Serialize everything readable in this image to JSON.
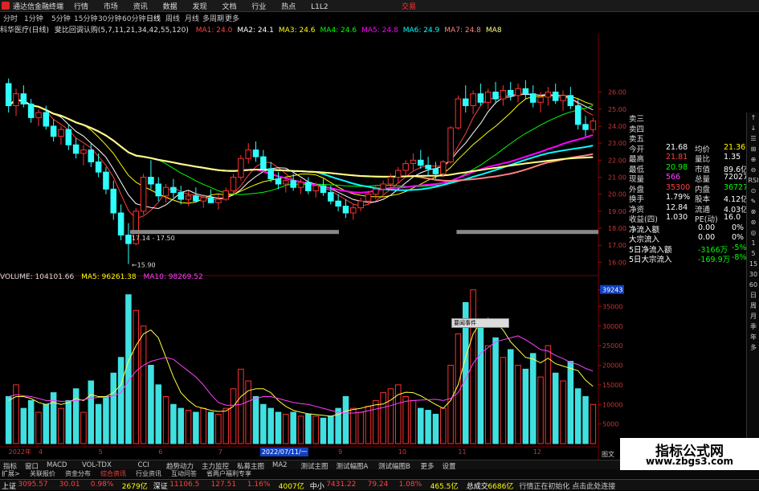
{
  "titlebar": {
    "app_title": "通达信金融终端",
    "menus": [
      "行情",
      "市场",
      "资讯",
      "数据",
      "发现",
      "文档",
      "行业",
      "热点",
      "L1L2"
    ],
    "trade": "交易"
  },
  "periods": [
    "分时",
    "1分钟",
    "5分钟",
    "15分钟",
    "30分钟",
    "60分钟",
    "日线",
    "周线",
    "月线",
    "多周期",
    "更多"
  ],
  "indicator_line": {
    "stock": "科华医疗(日线)",
    "formula": "斐比回调认购(5,7,11,21,34,42,55,120)",
    "mas": [
      {
        "label": "MA1: 24.0",
        "color": "#ff4040"
      },
      {
        "label": "MA2: 24.1",
        "color": "#ffffff"
      },
      {
        "label": "MA3: 24.6",
        "color": "#ffff00"
      },
      {
        "label": "MA4: 24.6",
        "color": "#00ff00"
      },
      {
        "label": "MA5: 24.8",
        "color": "#ff00ff"
      },
      {
        "label": "MA6: 24.9",
        "color": "#00ffff"
      },
      {
        "label": "MA7: 24.8",
        "color": "#ff8080"
      },
      {
        "label": "MA8",
        "color": "#ffff80"
      }
    ]
  },
  "price_axis": [
    "26.00",
    "25.00",
    "24.00",
    "23.00",
    "22.00",
    "21.00",
    "20.00",
    "19.00",
    "18.00",
    "17.00",
    "16.00"
  ],
  "price_annotations": {
    "low_label": "15.90",
    "range_label": "17.14 - 17.50"
  },
  "volume_line": {
    "volume": "VOLUME: 104101.66",
    "ma5": "MA5: 96261.38",
    "ma10": "MA10: 98269.52"
  },
  "volume_axis": [
    "39243",
    "35000",
    "30000",
    "25000",
    "20000",
    "15000",
    "10000",
    "5000"
  ],
  "volume_tooltip": "要闻事件",
  "date_axis": [
    "2022年",
    "4",
    "5",
    "6",
    "7",
    "8",
    "9",
    "10",
    "11",
    "12"
  ],
  "date_highlight": "2022/07/11/一",
  "quote": {
    "order_labels": [
      "卖三",
      "卖四",
      "卖五"
    ],
    "rows": [
      {
        "l1": "今开",
        "v1": "21.68",
        "c1": "#ffffff",
        "l2": "均价",
        "v2": "21.36",
        "c2": "#ffff00"
      },
      {
        "l1": "最高",
        "v1": "21.81",
        "c1": "#ff4040",
        "l2": "量比",
        "v2": "1.35",
        "c2": "#ffffff"
      },
      {
        "l1": "最低",
        "v1": "20.98",
        "c1": "#00ff00",
        "l2": "市值",
        "v2": "89.6亿",
        "c2": "#ffffff"
      },
      {
        "l1": "现量",
        "v1": "566",
        "c1": "#ff40ff",
        "l2": "总量",
        "v2": "72027",
        "c2": "#ffffff"
      },
      {
        "l1": "外盘",
        "v1": "35300",
        "c1": "#ff4040",
        "l2": "内盘",
        "v2": "36727",
        "c2": "#00ff00"
      },
      {
        "l1": "换手",
        "v1": "1.79%",
        "c1": "#ffffff",
        "l2": "股本",
        "v2": "4.12亿",
        "c2": "#ffffff"
      },
      {
        "l1": "净资",
        "v1": "12.84",
        "c1": "#ffffff",
        "l2": "流通",
        "v2": "4.03亿",
        "c2": "#ffffff"
      },
      {
        "l1": "收益(四)",
        "v1": "1.030",
        "c1": "#ffffff",
        "l2": "PE(动)",
        "v2": "16.0",
        "c2": "#ffffff"
      }
    ],
    "flows": [
      {
        "label": "净流入额",
        "v1": "0.00",
        "v2": "0%"
      },
      {
        "label": "大宗流入",
        "v1": "0.00",
        "v2": "0%"
      },
      {
        "label": "5日净流入额",
        "v1": "-3166万",
        "v2": "-5%"
      },
      {
        "label": "5日大宗流入",
        "v1": "-169.9万",
        "v2": "-8%"
      }
    ]
  },
  "right_toolbar": [
    "↑",
    "↓",
    "☰",
    "⊞",
    "⊕",
    "⊖",
    "RSI",
    "⊙",
    "✎",
    "⊗",
    "⊛",
    "◎",
    "1",
    "5",
    "15",
    "30",
    "60",
    "日",
    "周",
    "月",
    "季",
    "年",
    "多"
  ],
  "bottom_tabs": [
    "指标",
    "窗口",
    "MACD",
    "VOL-TDX",
    "CCI",
    "趋势动力",
    "主力监控",
    "私募主图",
    "MA2",
    "测试主图",
    "测试幅图A",
    "测试幅图B",
    "更多",
    "设置"
  ],
  "bottom_tabs2": [
    "扩展>",
    "关联报价",
    "资金分布",
    "综合资讯",
    "行业资讯",
    "互动问答",
    "省两户福利专享"
  ],
  "info_button": "图文F10",
  "statusbar": {
    "items": [
      {
        "text": "上证",
        "color": "#ffffff"
      },
      {
        "text": "3095.57",
        "color": "#ff4040"
      },
      {
        "text": "30.01",
        "color": "#ff4040"
      },
      {
        "text": "0.98%",
        "color": "#ff4040"
      },
      {
        "text": "2679亿",
        "color": "#ffff00"
      },
      {
        "text": "深证",
        "color": "#ffffff"
      },
      {
        "text": "11106.5",
        "color": "#ff4040"
      },
      {
        "text": "127.51",
        "color": "#ff4040"
      },
      {
        "text": "1.16%",
        "color": "#ff4040"
      },
      {
        "text": "4007亿",
        "color": "#ffff00"
      },
      {
        "text": "中小",
        "color": "#ffffff"
      },
      {
        "text": "7431.22",
        "color": "#ff4040"
      },
      {
        "text": "79.24",
        "color": "#ff4040"
      },
      {
        "text": "1.08%",
        "color": "#ff4040"
      },
      {
        "text": "465.5亿",
        "color": "#ffff00"
      },
      {
        "text": "总成交",
        "color": "#ffffff"
      },
      {
        "text": "6686亿",
        "color": "#ffff00"
      },
      {
        "text": "行情正在初始化 点击此处连接",
        "color": "#cccccc"
      }
    ]
  },
  "watermark": {
    "line1": "指标公式网",
    "line2": "www.zbgs3.com"
  },
  "chart_data": {
    "type": "candlestick",
    "price_ylim": [
      15.5,
      26.5
    ],
    "volume_ylim": [
      0,
      40000
    ],
    "candles": [
      [
        26.5,
        26.8,
        24.8,
        25.2
      ],
      [
        25.2,
        26.2,
        24.6,
        25.9
      ],
      [
        25.9,
        26.4,
        25.1,
        25.3
      ],
      [
        25.3,
        25.6,
        24.2,
        24.5
      ],
      [
        24.5,
        25.0,
        24.0,
        24.8
      ],
      [
        24.8,
        25.2,
        23.8,
        24.0
      ],
      [
        24.0,
        24.4,
        23.1,
        23.4
      ],
      [
        23.4,
        24.0,
        22.9,
        23.8
      ],
      [
        23.8,
        24.1,
        22.6,
        22.9
      ],
      [
        22.9,
        23.3,
        22.1,
        22.4
      ],
      [
        22.4,
        22.9,
        21.7,
        22.6
      ],
      [
        22.6,
        23.0,
        21.6,
        21.9
      ],
      [
        21.9,
        22.4,
        21.0,
        21.3
      ],
      [
        21.3,
        21.6,
        20.0,
        20.3
      ],
      [
        20.3,
        20.8,
        18.5,
        18.9
      ],
      [
        18.9,
        19.4,
        17.3,
        17.6
      ],
      [
        17.6,
        18.3,
        15.9,
        17.1
      ],
      [
        17.1,
        19.2,
        17.0,
        19.0
      ],
      [
        19.0,
        21.2,
        18.8,
        21.0
      ],
      [
        21.0,
        22.0,
        20.3,
        20.6
      ],
      [
        20.6,
        21.0,
        19.6,
        19.9
      ],
      [
        19.9,
        20.6,
        19.5,
        20.4
      ],
      [
        20.4,
        20.9,
        19.8,
        20.1
      ],
      [
        20.1,
        20.5,
        19.4,
        19.7
      ],
      [
        19.7,
        20.2,
        19.3,
        19.9
      ],
      [
        19.9,
        20.4,
        19.5,
        19.6
      ],
      [
        19.6,
        20.0,
        19.2,
        19.8
      ],
      [
        19.8,
        20.3,
        19.5,
        19.5
      ],
      [
        19.5,
        20.0,
        19.1,
        19.7
      ],
      [
        19.7,
        20.4,
        19.6,
        20.2
      ],
      [
        20.2,
        21.2,
        20.0,
        21.0
      ],
      [
        21.0,
        22.3,
        20.8,
        22.1
      ],
      [
        22.1,
        23.0,
        21.8,
        22.6
      ],
      [
        22.6,
        23.1,
        21.9,
        22.2
      ],
      [
        22.2,
        22.6,
        21.3,
        21.5
      ],
      [
        21.5,
        21.9,
        20.7,
        20.9
      ],
      [
        20.9,
        21.3,
        20.3,
        20.6
      ],
      [
        20.6,
        21.0,
        20.1,
        20.8
      ],
      [
        20.8,
        21.2,
        20.2,
        20.4
      ],
      [
        20.4,
        20.9,
        20.0,
        20.7
      ],
      [
        20.7,
        21.0,
        20.0,
        20.2
      ],
      [
        20.2,
        20.7,
        19.8,
        20.5
      ],
      [
        20.5,
        20.9,
        19.9,
        20.1
      ],
      [
        20.1,
        20.5,
        19.4,
        19.6
      ],
      [
        19.6,
        20.0,
        19.0,
        19.3
      ],
      [
        19.3,
        19.7,
        18.6,
        18.9
      ],
      [
        18.9,
        19.4,
        18.5,
        19.2
      ],
      [
        19.2,
        19.8,
        19.0,
        19.6
      ],
      [
        19.6,
        20.2,
        19.4,
        20.0
      ],
      [
        20.0,
        20.5,
        19.7,
        20.3
      ],
      [
        20.3,
        20.8,
        20.0,
        20.6
      ],
      [
        20.6,
        21.2,
        20.3,
        21.0
      ],
      [
        21.0,
        21.6,
        20.7,
        21.4
      ],
      [
        21.4,
        22.0,
        21.1,
        21.8
      ],
      [
        21.8,
        22.4,
        21.4,
        22.0
      ],
      [
        22.0,
        22.6,
        21.5,
        21.7
      ],
      [
        21.7,
        22.2,
        21.1,
        21.5
      ],
      [
        21.5,
        21.9,
        20.9,
        21.2
      ],
      [
        21.2,
        22.0,
        21.0,
        21.9
      ],
      [
        21.9,
        24.0,
        21.8,
        23.9
      ],
      [
        23.9,
        25.8,
        23.8,
        25.6
      ],
      [
        25.6,
        26.4,
        24.8,
        25.2
      ],
      [
        25.2,
        26.1,
        24.7,
        25.9
      ],
      [
        25.9,
        26.5,
        25.2,
        25.4
      ],
      [
        25.4,
        26.2,
        25.0,
        26.0
      ],
      [
        26.0,
        26.6,
        25.3,
        25.6
      ],
      [
        25.6,
        26.4,
        25.2,
        26.1
      ],
      [
        26.1,
        26.6,
        25.5,
        25.8
      ],
      [
        25.8,
        26.5,
        25.4,
        26.2
      ],
      [
        26.2,
        26.7,
        25.6,
        25.9
      ],
      [
        25.9,
        26.4,
        25.1,
        25.4
      ],
      [
        25.4,
        26.0,
        24.8,
        25.7
      ],
      [
        25.7,
        26.3,
        25.2,
        26.0
      ],
      [
        26.0,
        26.5,
        25.3,
        25.5
      ],
      [
        25.5,
        26.1,
        24.9,
        25.8
      ],
      [
        25.8,
        26.3,
        25.0,
        25.2
      ],
      [
        25.2,
        25.6,
        23.8,
        24.1
      ],
      [
        24.1,
        24.6,
        23.4,
        23.8
      ],
      [
        23.8,
        24.5,
        23.6,
        24.3
      ]
    ],
    "volumes": [
      12000,
      15000,
      9000,
      11000,
      8000,
      10000,
      13000,
      9000,
      11000,
      14000,
      8000,
      16000,
      10000,
      12000,
      18000,
      22000,
      38000,
      34000,
      30000,
      20000,
      15000,
      12000,
      10000,
      9000,
      8500,
      8000,
      9000,
      8000,
      7500,
      9000,
      14000,
      19000,
      16000,
      12000,
      10000,
      9000,
      8000,
      7500,
      8000,
      7000,
      7500,
      7000,
      6500,
      7000,
      9000,
      12000,
      9000,
      8000,
      9500,
      11000,
      13000,
      14000,
      15000,
      12000,
      11000,
      9000,
      8500,
      7500,
      9000,
      20000,
      28000,
      36000,
      39243,
      30000,
      25000,
      27000,
      22000,
      24000,
      20000,
      19000,
      23000,
      17000,
      25000,
      18000,
      16000,
      21000,
      14000,
      12000,
      10000
    ],
    "volume_ma5": [
      11000,
      12000,
      12000,
      11500,
      10500,
      10000,
      10500,
      10000,
      10500,
      11500,
      11000,
      12500,
      12000,
      12000,
      13000,
      15000,
      21000,
      25000,
      28000,
      29000,
      27000,
      22000,
      17000,
      13000,
      11000,
      9500,
      9000,
      8500,
      8200,
      8300,
      9500,
      12000,
      13500,
      14000,
      14000,
      13000,
      11000,
      9500,
      8500,
      8000,
      7600,
      7400,
      7200,
      7000,
      7400,
      8300,
      8700,
      9000,
      9500,
      9900,
      10100,
      11100,
      12500,
      13100,
      13000,
      12200,
      11100,
      10000,
      9000,
      11000,
      15000,
      22000,
      28000,
      31000,
      32000,
      31000,
      29000,
      26000,
      24000,
      22000,
      21600,
      20600,
      21800,
      20400,
      19800,
      19200,
      18600,
      16200,
      14600
    ],
    "volume_ma10": [
      12000,
      12500,
      12200,
      12000,
      11500,
      11000,
      11000,
      10800,
      10800,
      11000,
      11200,
      11600,
      11800,
      11800,
      12200,
      13000,
      16000,
      18500,
      20000,
      21000,
      21500,
      22000,
      21500,
      20000,
      18500,
      17000,
      15000,
      12500,
      10500,
      9800,
      9800,
      10000,
      10800,
      11500,
      12000,
      12000,
      11500,
      11000,
      10500,
      10200,
      10000,
      9500,
      9000,
      8500,
      8000,
      7800,
      7800,
      8000,
      8400,
      8800,
      9200,
      9700,
      10300,
      10800,
      11000,
      11100,
      11200,
      11300,
      11000,
      11500,
      13000,
      16500,
      20500,
      23000,
      24500,
      26000,
      26500,
      27000,
      27500,
      26500,
      25300,
      24000,
      23600,
      22500,
      21700,
      20700,
      20200,
      19200,
      18500
    ]
  }
}
